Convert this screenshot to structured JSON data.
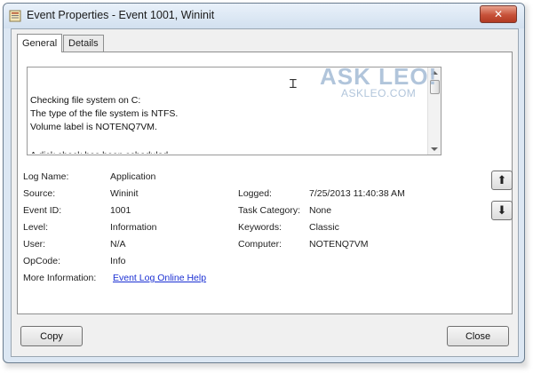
{
  "window": {
    "title": "Event Properties - Event 1001, Wininit",
    "close_glyph": "✕"
  },
  "tabs": [
    {
      "label": "General",
      "selected": true
    },
    {
      "label": "Details",
      "selected": false
    }
  ],
  "description": {
    "text": "Checking file system on C:\nThe type of the file system is NTFS.\nVolume label is NOTENQ7VM.",
    "partial_next_line": "A disk check has been scheduled."
  },
  "watermark": {
    "title": "ASK LEO!",
    "subtitle": "ASKLEO.COM"
  },
  "fields": {
    "log_name": {
      "label": "Log Name:",
      "value": "Application"
    },
    "source": {
      "label": "Source:",
      "value": "Wininit"
    },
    "event_id": {
      "label": "Event ID:",
      "value": "1001"
    },
    "level": {
      "label": "Level:",
      "value": "Information"
    },
    "user": {
      "label": "User:",
      "value": "N/A"
    },
    "opcode": {
      "label": "OpCode:",
      "value": "Info"
    },
    "more_info": {
      "label": "More Information:",
      "link_text": "Event Log Online Help"
    },
    "logged": {
      "label": "Logged:",
      "value": "7/25/2013 11:40:38 AM"
    },
    "task_category": {
      "label": "Task Category:",
      "value": "None"
    },
    "keywords": {
      "label": "Keywords:",
      "value": "Classic"
    },
    "computer": {
      "label": "Computer:",
      "value": "NOTENQ7VM"
    }
  },
  "nav": {
    "up_glyph": "⬆",
    "down_glyph": "⬇"
  },
  "buttons": {
    "copy": "Copy",
    "close": "Close"
  }
}
